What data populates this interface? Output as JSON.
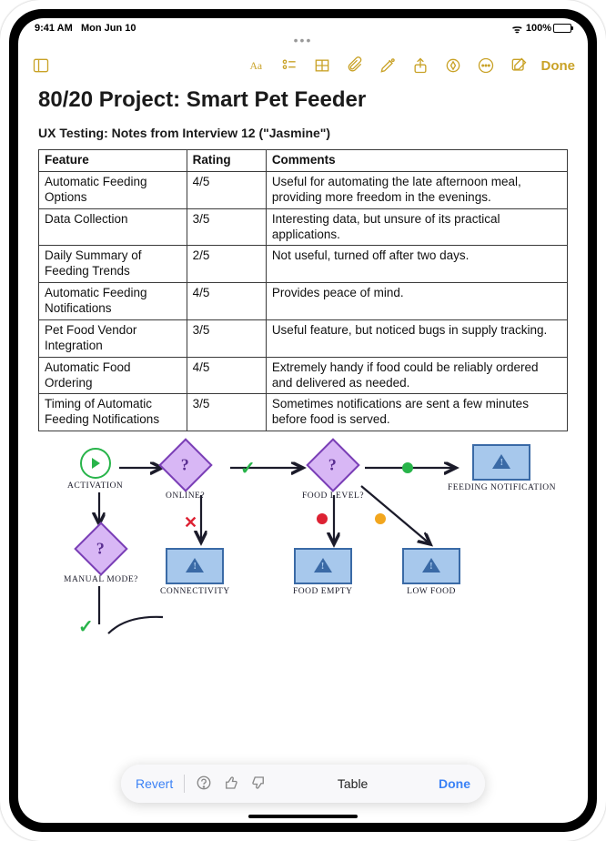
{
  "status": {
    "time": "9:41 AM",
    "date": "Mon Jun 10",
    "battery": "100%"
  },
  "toolbar": {
    "done": "Done"
  },
  "note": {
    "title": "80/20 Project: Smart Pet Feeder",
    "subtitle": "UX Testing: Notes from Interview 12 (\"Jasmine\")",
    "table": {
      "headers": [
        "Feature",
        "Rating",
        "Comments"
      ],
      "rows": [
        {
          "feature": "Automatic Feeding Options",
          "rating": "4/5",
          "comments": "Useful for automating the late afternoon meal, providing more freedom in the evenings."
        },
        {
          "feature": "Data Collection",
          "rating": "3/5",
          "comments": "Interesting data, but unsure of its practical applications."
        },
        {
          "feature": "Daily Summary of Feeding Trends",
          "rating": "2/5",
          "comments": "Not useful, turned off after two days."
        },
        {
          "feature": "Automatic Feeding Notifications",
          "rating": "4/5",
          "comments": "Provides peace of mind."
        },
        {
          "feature": "Pet Food Vendor Integration",
          "rating": "3/5",
          "comments": "Useful feature, but noticed bugs in supply tracking."
        },
        {
          "feature": "Automatic Food Ordering",
          "rating": "4/5",
          "comments": "Extremely handy if food could be reliably ordered and delivered as needed."
        },
        {
          "feature": "Timing of Automatic Feeding Notifications",
          "rating": "3/5",
          "comments": "Sometimes notifications are sent a few minutes before food is served."
        }
      ]
    }
  },
  "sketch": {
    "nodes": {
      "activation": "Activation",
      "online": "Online?",
      "foodlevel": "Food Level?",
      "feednotif": "Feeding Notification",
      "manual": "Manual Mode?",
      "connectivity": "Connectivity",
      "foodempty": "Food Empty",
      "lowfood": "Low Food"
    }
  },
  "popup": {
    "revert": "Revert",
    "label": "Table",
    "done": "Done"
  }
}
